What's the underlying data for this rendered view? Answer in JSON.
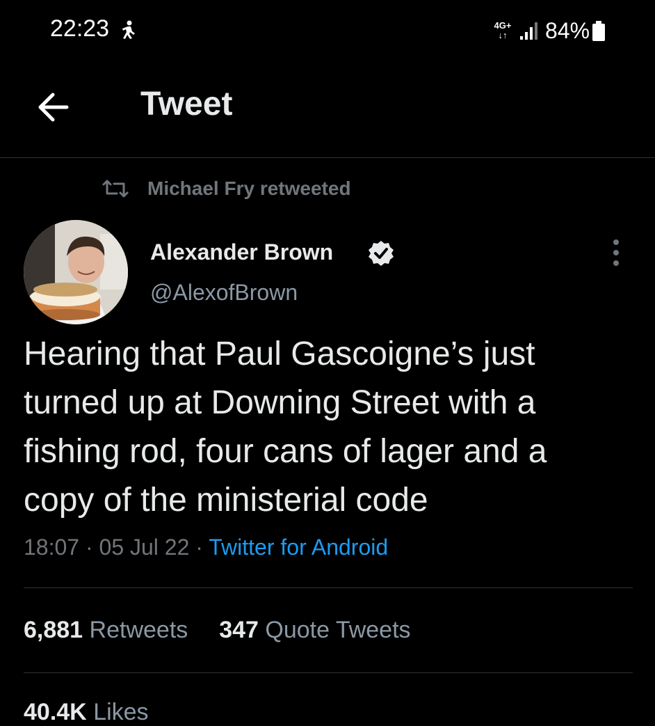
{
  "status_bar": {
    "time": "22:23",
    "network": "4G+",
    "battery": "84%"
  },
  "header": {
    "title": "Tweet"
  },
  "retweet_context": {
    "label": "Michael Fry retweeted"
  },
  "tweet": {
    "author_name": "Alexander Brown",
    "author_handle": "@AlexofBrown",
    "verified": true,
    "text_lines": [
      "Hearing that Paul Gascoigne’s just",
      "turned up at Downing Street with a",
      "fishing rod, four cans of lager and a",
      "copy of the ministerial code"
    ],
    "time": "18:07",
    "date": "05 Jul 22",
    "separator": " · ",
    "source": "Twitter for Android"
  },
  "stats": {
    "retweets_count": "6,881",
    "retweets_label": "Retweets",
    "quotes_count": "347",
    "quotes_label": "Quote Tweets",
    "likes_count": "40.4K",
    "likes_label": "Likes"
  },
  "colors": {
    "background": "#000000",
    "text_primary": "#e7e9ea",
    "text_secondary": "#71767b",
    "link": "#1d9bf0",
    "divider": "#2f3336"
  },
  "icons": {
    "back": "arrow-left-icon",
    "retweet": "retweet-icon",
    "verified": "verified-badge-icon",
    "more": "more-vertical-icon"
  }
}
